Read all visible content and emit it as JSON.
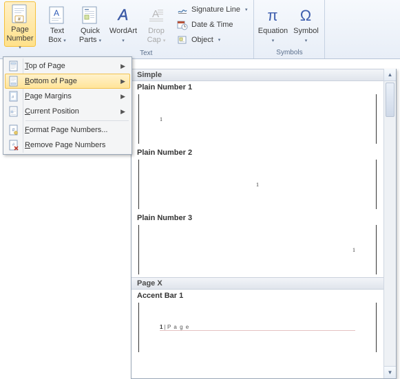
{
  "ribbon": {
    "page_number": {
      "label1": "Page",
      "label2": "Number"
    },
    "text_box": {
      "label1": "Text",
      "label2": "Box"
    },
    "quick_parts": {
      "label1": "Quick",
      "label2": "Parts"
    },
    "wordart": {
      "label": "WordArt"
    },
    "drop_cap": {
      "label1": "Drop",
      "label2": "Cap"
    },
    "text_group_items": {
      "signature": "Signature Line",
      "datetime": "Date & Time",
      "object": "Object"
    },
    "equation": {
      "label": "Equation"
    },
    "symbol": {
      "label": "Symbol"
    },
    "groups": {
      "text": "Text",
      "symbols": "Symbols"
    }
  },
  "menu": {
    "top": {
      "pre": "T",
      "rest": "op of Page"
    },
    "bottom": {
      "pre": "B",
      "rest": "ottom of Page"
    },
    "margins": {
      "pre": "P",
      "rest": "age Margins"
    },
    "current": {
      "pre": "C",
      "rest": "urrent Position"
    },
    "format": {
      "pre": "F",
      "rest": "ormat Page Numbers..."
    },
    "remove": {
      "pre": "R",
      "rest": "emove Page Numbers"
    }
  },
  "gallery": {
    "cat1": "Simple",
    "item1": {
      "title": "Plain Number 1",
      "value": "1"
    },
    "item2": {
      "title": "Plain Number 2",
      "value": "1"
    },
    "item3": {
      "title": "Plain Number 3",
      "value": "1"
    },
    "cat2": "Page X",
    "item4": {
      "title": "Accent Bar 1",
      "num": "1",
      "sep": " | ",
      "word": "P a g e"
    }
  }
}
